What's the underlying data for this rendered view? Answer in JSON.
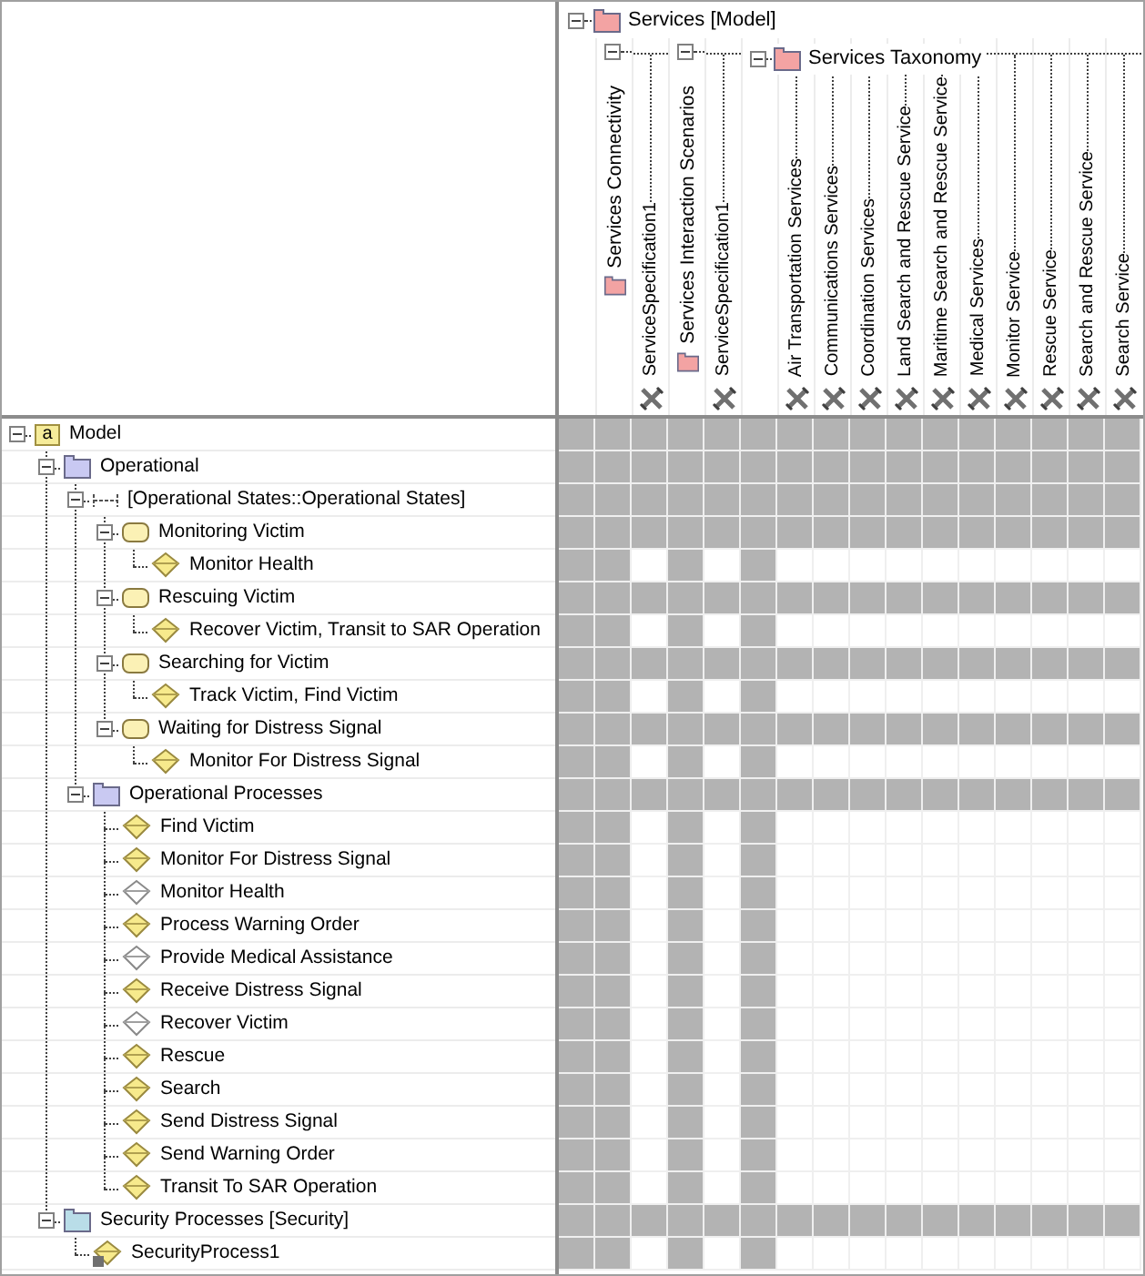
{
  "columns": {
    "label": "Services [Model]",
    "kind": "root",
    "color": "#f3a3a3",
    "expanded": true,
    "children": [
      {
        "label": "Services Connectivity",
        "kind": "package",
        "color": "#f3a3a3",
        "expanded": true,
        "children": [
          {
            "label": "ServiceSpecification1",
            "kind": "element"
          }
        ]
      },
      {
        "label": "Services Interaction Scenarios",
        "kind": "package",
        "color": "#f3a3a3",
        "expanded": true,
        "children": [
          {
            "label": "ServiceSpecification1",
            "kind": "element"
          }
        ]
      },
      {
        "label": "Services Taxonomy",
        "kind": "group",
        "color": "#f3a3a3",
        "expanded": true,
        "children": [
          {
            "label": "Air Transportation Services",
            "kind": "element"
          },
          {
            "label": "Communications Services",
            "kind": "element"
          },
          {
            "label": "Coordination Services",
            "kind": "element"
          },
          {
            "label": "Land Search and Rescue Service",
            "kind": "element"
          },
          {
            "label": "Maritime Search and Rescue Service",
            "kind": "element"
          },
          {
            "label": "Medical Services",
            "kind": "element"
          },
          {
            "label": "Monitor Service",
            "kind": "element"
          },
          {
            "label": "Rescue Service",
            "kind": "element"
          },
          {
            "label": "Search and Rescue Service",
            "kind": "element"
          },
          {
            "label": "Search Service",
            "kind": "element"
          }
        ]
      }
    ]
  },
  "rows": [
    {
      "label": "Model",
      "kind": "model",
      "icon_letter": "a",
      "expanded": true,
      "children": [
        {
          "label": "Operational",
          "kind": "package",
          "color": "#c9c9f2",
          "expanded": true,
          "children": [
            {
              "label": "[Operational States::Operational States]",
              "kind": "region",
              "expanded": true,
              "children": [
                {
                  "label": "Monitoring Victim",
                  "kind": "state",
                  "expanded": true,
                  "children": [
                    {
                      "label": "Monitor Health",
                      "kind": "activity",
                      "filled": true
                    }
                  ]
                },
                {
                  "label": "Rescuing Victim",
                  "kind": "state",
                  "expanded": true,
                  "children": [
                    {
                      "label": "Recover Victim, Transit to SAR Operation",
                      "kind": "activity",
                      "filled": true
                    }
                  ]
                },
                {
                  "label": "Searching for Victim",
                  "kind": "state",
                  "expanded": true,
                  "children": [
                    {
                      "label": "Track Victim, Find Victim",
                      "kind": "activity",
                      "filled": true
                    }
                  ]
                },
                {
                  "label": "Waiting for Distress Signal",
                  "kind": "state",
                  "expanded": true,
                  "children": [
                    {
                      "label": "Monitor For Distress Signal",
                      "kind": "activity",
                      "filled": true
                    }
                  ]
                }
              ]
            },
            {
              "label": "Operational Processes",
              "kind": "package",
              "color": "#c9c9f2",
              "expanded": true,
              "children": [
                {
                  "label": "Find Victim",
                  "kind": "activity",
                  "filled": true
                },
                {
                  "label": "Monitor For Distress Signal",
                  "kind": "activity",
                  "filled": true
                },
                {
                  "label": "Monitor Health",
                  "kind": "activity",
                  "filled": false
                },
                {
                  "label": "Process Warning Order",
                  "kind": "activity",
                  "filled": true
                },
                {
                  "label": "Provide Medical Assistance",
                  "kind": "activity",
                  "filled": false
                },
                {
                  "label": "Receive Distress Signal",
                  "kind": "activity",
                  "filled": true
                },
                {
                  "label": "Recover Victim",
                  "kind": "activity",
                  "filled": false
                },
                {
                  "label": "Rescue",
                  "kind": "activity",
                  "filled": true
                },
                {
                  "label": "Search",
                  "kind": "activity",
                  "filled": true
                },
                {
                  "label": "Send Distress Signal",
                  "kind": "activity",
                  "filled": true
                },
                {
                  "label": "Send Warning Order",
                  "kind": "activity",
                  "filled": true
                },
                {
                  "label": "Transit To SAR Operation",
                  "kind": "activity",
                  "filled": true
                }
              ]
            }
          ]
        },
        {
          "label": "Security Processes [Security]",
          "kind": "package",
          "color": "#b9dde8",
          "expanded": true,
          "children": [
            {
              "label": "SecurityProcess1",
              "kind": "locked",
              "filled": true
            }
          ]
        }
      ]
    }
  ]
}
